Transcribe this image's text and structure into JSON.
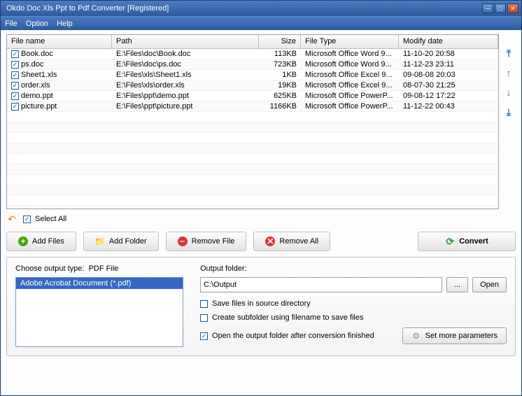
{
  "window": {
    "title": "Okdo Doc Xls Ppt to Pdf Converter [Registered]"
  },
  "menu": {
    "file": "File",
    "option": "Option",
    "help": "Help"
  },
  "table": {
    "headers": {
      "name": "File name",
      "path": "Path",
      "size": "Size",
      "type": "File Type",
      "date": "Modify date"
    },
    "rows": [
      {
        "name": "Book.doc",
        "path": "E:\\Files\\doc\\Book.doc",
        "size": "113KB",
        "type": "Microsoft Office Word 9...",
        "date": "11-10-20 20:58"
      },
      {
        "name": "ps.doc",
        "path": "E:\\Files\\doc\\ps.doc",
        "size": "723KB",
        "type": "Microsoft Office Word 9...",
        "date": "11-12-23 23:11"
      },
      {
        "name": "Sheet1.xls",
        "path": "E:\\Files\\xls\\Sheet1.xls",
        "size": "1KB",
        "type": "Microsoft Office Excel 9...",
        "date": "09-08-08 20:03"
      },
      {
        "name": "order.xls",
        "path": "E:\\Files\\xls\\order.xls",
        "size": "19KB",
        "type": "Microsoft Office Excel 9...",
        "date": "08-07-30 21:25"
      },
      {
        "name": "demo.ppt",
        "path": "E:\\Files\\ppt\\demo.ppt",
        "size": "625KB",
        "type": "Microsoft Office PowerP...",
        "date": "09-08-12 17:22"
      },
      {
        "name": "picture.ppt",
        "path": "E:\\Files\\ppt\\picture.ppt",
        "size": "1166KB",
        "type": "Microsoft Office PowerP...",
        "date": "11-12-22 00:43"
      }
    ]
  },
  "selectall": "Select All",
  "buttons": {
    "addFiles": "Add Files",
    "addFolder": "Add Folder",
    "removeFile": "Remove File",
    "removeAll": "Remove All",
    "convert": "Convert"
  },
  "output": {
    "typeLabel": "Choose output type:",
    "typeVal": "PDF File",
    "listItem": "Adobe Acrobat Document (*.pdf)",
    "folderLabel": "Output folder:",
    "folderPath": "C:\\Output",
    "browse": "...",
    "open": "Open",
    "saveSource": "Save files in source directory",
    "subfolder": "Create subfolder using filename to save files",
    "openAfter": "Open the output folder after conversion finished",
    "params": "Set more parameters"
  }
}
